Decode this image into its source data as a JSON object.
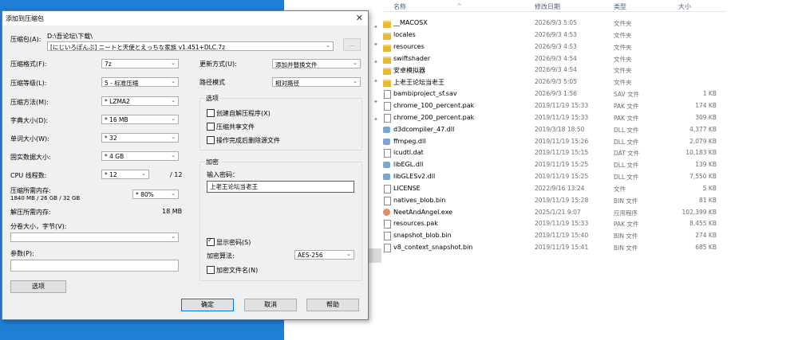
{
  "dialog": {
    "title": "添加到压缩包",
    "archive_label": "压缩包(A):",
    "archive_path": "D:\\吾论坛\\下载\\",
    "archive_name": "[にじいろぽんぷ] ニートと天使とえっちな家族 v1.451+DLC.7z",
    "browse_label": "...",
    "format_label": "压缩格式(F):",
    "format_value": "7z",
    "level_label": "压缩等级(L):",
    "level_value": "5 - 标准压缩",
    "method_label": "压缩方法(M):",
    "method_value": "* LZMA2",
    "dict_label": "字典大小(D):",
    "dict_value": "* 16 MB",
    "word_label": "单词大小(W):",
    "word_value": "* 32",
    "solid_label": "固实数据大小:",
    "solid_value": "* 4 GB",
    "threads_label": "CPU 线程数:",
    "threads_value": "* 12",
    "threads_total": "/ 12",
    "mem_label": "压缩所需内存:",
    "mem_detail": "1840 MB / 26 GB / 32 GB",
    "mem_value": "* 80%",
    "decomp_label": "解压所需内存:",
    "decomp_value": "18 MB",
    "split_label": "分卷大小，字节(V):",
    "split_value": "",
    "params_label": "参数(P):",
    "params_value": "",
    "options_button": "选项",
    "update_label": "更新方式(U):",
    "update_value": "添加并替换文件",
    "path_label": "路径模式",
    "path_value": "相对路径",
    "options_group": "选项",
    "opt_sfx": "创建自解压程序(X)",
    "opt_shared": "压缩共享文件",
    "opt_delete": "操作完成后删除源文件",
    "enc_group": "加密",
    "pwd_label": "输入密码：",
    "pwd_value": "上老王论坛当老王",
    "show_pwd": "显示密码(S)",
    "enc_method_label": "加密算法:",
    "enc_method_value": "AES-256",
    "enc_names": "加密文件名(N)",
    "ok": "确定",
    "cancel": "取消",
    "help": "帮助"
  },
  "explorer": {
    "headers": {
      "name": "名称",
      "date": "修改日期",
      "type": "类型",
      "size": "大小"
    },
    "files": [
      {
        "name": "__MACOSX",
        "date": "2026/9/3 5:05",
        "type": "文件夹",
        "size": "",
        "icon": "folder"
      },
      {
        "name": "locales",
        "date": "2026/9/3 4:53",
        "type": "文件夹",
        "size": "",
        "icon": "folder"
      },
      {
        "name": "resources",
        "date": "2026/9/3 4:53",
        "type": "文件夹",
        "size": "",
        "icon": "folder"
      },
      {
        "name": "swiftshader",
        "date": "2026/9/3 4:54",
        "type": "文件夹",
        "size": "",
        "icon": "folder"
      },
      {
        "name": "安卓模拟器",
        "date": "2026/9/3 4:54",
        "type": "文件夹",
        "size": "",
        "icon": "folder"
      },
      {
        "name": "上老王论坛当老王",
        "date": "2026/9/3 5:05",
        "type": "文件夹",
        "size": "",
        "icon": "folder"
      },
      {
        "name": "bambiproject_sf.sav",
        "date": "2026/9/3 1:56",
        "type": "SAV 文件",
        "size": "1 KB",
        "icon": "file"
      },
      {
        "name": "chrome_100_percent.pak",
        "date": "2019/11/19 15:33",
        "type": "PAK 文件",
        "size": "174 KB",
        "icon": "file"
      },
      {
        "name": "chrome_200_percent.pak",
        "date": "2019/11/19 15:33",
        "type": "PAK 文件",
        "size": "309 KB",
        "icon": "file"
      },
      {
        "name": "d3dcompiler_47.dll",
        "date": "2019/3/18 18:50",
        "type": "DLL 文件",
        "size": "4,377 KB",
        "icon": "dll"
      },
      {
        "name": "ffmpeg.dll",
        "date": "2019/11/19 15:26",
        "type": "DLL 文件",
        "size": "2,079 KB",
        "icon": "dll"
      },
      {
        "name": "icudtl.dat",
        "date": "2019/11/19 15:15",
        "type": "DAT 文件",
        "size": "10,183 KB",
        "icon": "file"
      },
      {
        "name": "libEGL.dll",
        "date": "2019/11/19 15:25",
        "type": "DLL 文件",
        "size": "139 KB",
        "icon": "dll"
      },
      {
        "name": "libGLESv2.dll",
        "date": "2019/11/19 15:25",
        "type": "DLL 文件",
        "size": "7,550 KB",
        "icon": "dll"
      },
      {
        "name": "LICENSE",
        "date": "2022/9/16 13:24",
        "type": "文件",
        "size": "5 KB",
        "icon": "file"
      },
      {
        "name": "natives_blob.bin",
        "date": "2019/11/19 15:28",
        "type": "BIN 文件",
        "size": "81 KB",
        "icon": "file"
      },
      {
        "name": "NeetAndAngel.exe",
        "date": "2025/1/21 9:07",
        "type": "应用程序",
        "size": "102,399 KB",
        "icon": "exe"
      },
      {
        "name": "resources.pak",
        "date": "2019/11/19 15:33",
        "type": "PAK 文件",
        "size": "8,455 KB",
        "icon": "file"
      },
      {
        "name": "snapshot_blob.bin",
        "date": "2019/11/19 15:40",
        "type": "BIN 文件",
        "size": "274 KB",
        "icon": "file"
      },
      {
        "name": "v8_context_snapshot.bin",
        "date": "2019/11/19 15:41",
        "type": "BIN 文件",
        "size": "685 KB",
        "icon": "file"
      }
    ]
  }
}
